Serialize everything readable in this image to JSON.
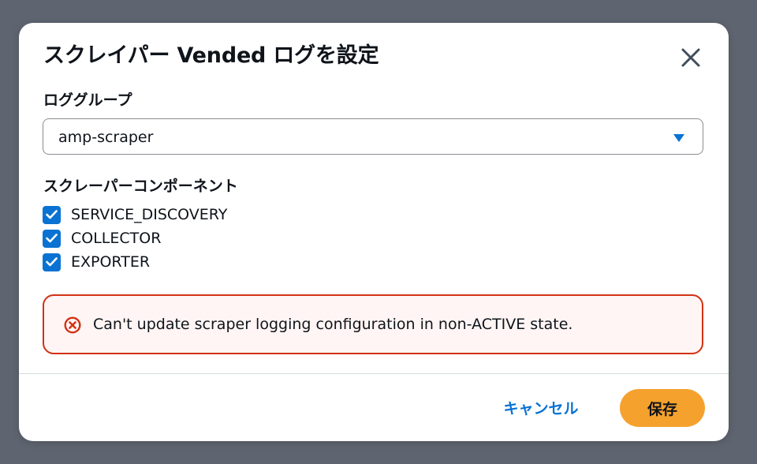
{
  "modal": {
    "title": "スクレイパー Vended ログを設定",
    "close_icon": "close-icon"
  },
  "log_group": {
    "label": "ロググループ",
    "selected_value": "amp-scraper",
    "caret_icon": "caret-down-icon"
  },
  "components": {
    "label": "スクレーパーコンポーネント",
    "items": [
      {
        "label": "SERVICE_DISCOVERY",
        "checked": true
      },
      {
        "label": "COLLECTOR",
        "checked": true
      },
      {
        "label": "EXPORTER",
        "checked": true
      }
    ]
  },
  "alert": {
    "icon": "error-icon",
    "message": "Can't update scraper logging configuration in non-ACTIVE state."
  },
  "footer": {
    "cancel_label": "キャンセル",
    "save_label": "保存"
  },
  "colors": {
    "accent": "#0972d3",
    "error": "#d13212",
    "primary_button": "#f5a12d",
    "overlay": "#5f6570"
  }
}
